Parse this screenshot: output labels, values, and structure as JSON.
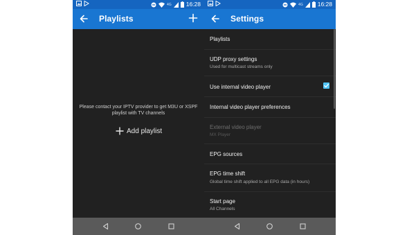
{
  "status_bar": {
    "time": "16:28",
    "network": "4G"
  },
  "playlists_screen": {
    "title": "Playlists",
    "empty_message": "Please contact your IPTV provider to get M3U or XSPF playlist with TV channels",
    "add_playlist_label": "Add playlist"
  },
  "settings_screen": {
    "title": "Settings",
    "items": [
      {
        "label": "Playlists",
        "sub": ""
      },
      {
        "label": "UDP proxy settings",
        "sub": "Used for multicast streams only"
      },
      {
        "label": "Use internal video player",
        "sub": "",
        "checked": true
      },
      {
        "label": "Internal video player preferences",
        "sub": ""
      },
      {
        "label": "External video player",
        "sub": "MX Player",
        "disabled": true
      },
      {
        "label": "EPG sources",
        "sub": ""
      },
      {
        "label": "EPG time shift",
        "sub": "Global time shift applied to all EPG data (in hours)"
      },
      {
        "label": "Start page",
        "sub": "All Channels"
      }
    ]
  },
  "colors": {
    "status_bar": "#1565c0",
    "app_bar": "#1976d2",
    "background": "#212121",
    "checkbox_accent": "#4fc3f7",
    "nav_bar": "#5a5a5a"
  }
}
